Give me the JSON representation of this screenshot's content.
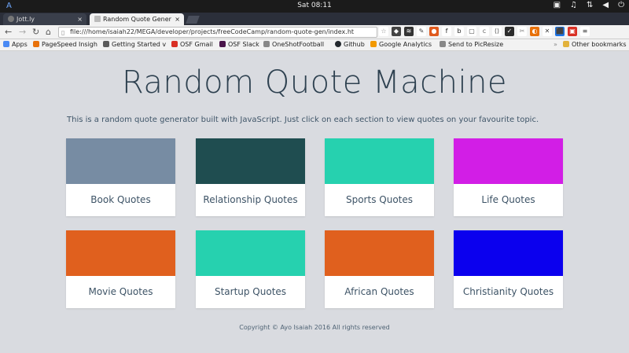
{
  "system": {
    "logo": "A",
    "clock": "Sat 08:11",
    "tray_icons": [
      "monitor-icon",
      "music-icon",
      "network-icon",
      "volume-icon",
      "power-icon"
    ]
  },
  "tabs": [
    {
      "label": "Jott.ly",
      "active": false
    },
    {
      "label": "Random Quote Gener",
      "active": true
    }
  ],
  "address_bar": {
    "url": "file:///home/isaiah22/MEGA/developer/projects/freeCodeCamp/random-quote-gen/index.ht"
  },
  "bookmarks": [
    {
      "label": "Apps",
      "color": "#4a8af4"
    },
    {
      "label": "PageSpeed Insigh",
      "color": "#e8710a"
    },
    {
      "label": "Getting Started v",
      "color": "#5b5b5b"
    },
    {
      "label": "OSF Gmail",
      "color": "#d93025"
    },
    {
      "label": "OSF Slack",
      "color": "#4a154b"
    },
    {
      "label": "OneShotFootball",
      "color": "#888888"
    },
    {
      "label": "Github",
      "color": "#24292e"
    },
    {
      "label": "Google Analytics",
      "color": "#f29900"
    },
    {
      "label": "Send to PicResize",
      "color": "#888888"
    },
    {
      "label": "Other bookmarks",
      "color": "#e2b23c"
    }
  ],
  "page": {
    "title": "Random Quote Machine",
    "description": "This is a random quote generator built with JavaScript. Just click on each section to view quotes on your favourite topic.",
    "cards": [
      {
        "label": "Book Quotes",
        "color": "#778ca3"
      },
      {
        "label": "Relationship Quotes",
        "color": "#1f4d50"
      },
      {
        "label": "Sports Quotes",
        "color": "#26d1af"
      },
      {
        "label": "Life Quotes",
        "color": "#d21ee6"
      },
      {
        "label": "Movie Quotes",
        "color": "#e0601e"
      },
      {
        "label": "Startup Quotes",
        "color": "#26d1af"
      },
      {
        "label": "African Quotes",
        "color": "#e0601e"
      },
      {
        "label": "Christianity Quotes",
        "color": "#0b00ee"
      }
    ],
    "footer": "Copyright © Ayo Isaiah 2016  All rights reserved"
  }
}
